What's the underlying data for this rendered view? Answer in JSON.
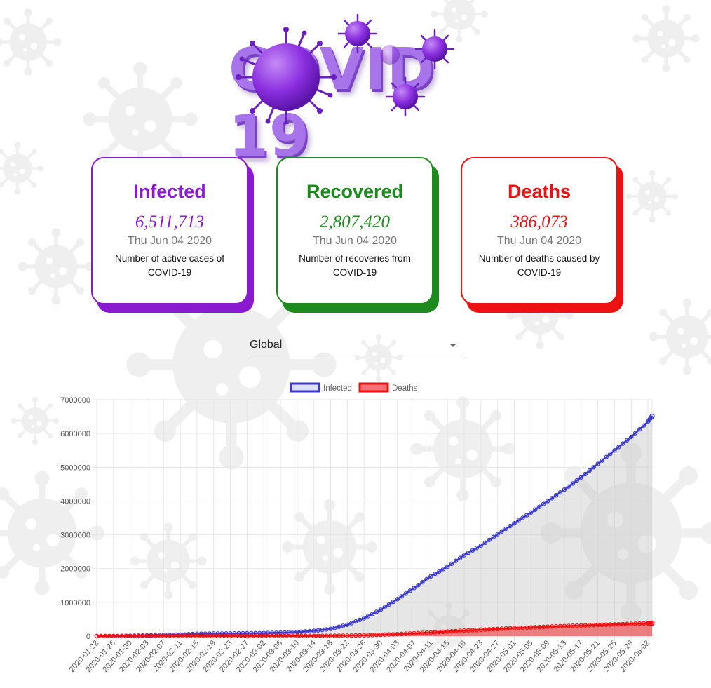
{
  "header": {
    "logo_text": "COVID 19"
  },
  "cards": [
    {
      "id": "infected",
      "title": "Infected",
      "value": "6,511,713",
      "date": "Thu Jun 04 2020",
      "description": "Number of active cases of COVID-19",
      "color": "#8a1ad0",
      "shadow_color": "#8a1ad0"
    },
    {
      "id": "recovered",
      "title": "Recovered",
      "value": "2,807,420",
      "date": "Thu Jun 04 2020",
      "description": "Number of recoveries from COVID-19",
      "color": "#1c8a1c",
      "shadow_color": "#1c8a1c"
    },
    {
      "id": "deaths",
      "title": "Deaths",
      "value": "386,073",
      "date": "Thu Jun 04 2020",
      "description": "Number of deaths caused by COVID-19",
      "color": "#ee1111",
      "shadow_color": "#ee1111"
    }
  ],
  "country_select": {
    "selected": "Global"
  },
  "colors": {
    "infected_line": "#3a3ad0",
    "infected_fill": "rgba(200,200,200,0.45)",
    "deaths_line": "#ee1111",
    "deaths_fill": "rgba(238,40,40,0.55)",
    "grid": "#e6e6e6"
  },
  "chart_data": {
    "type": "line",
    "x_start": "2020-01-22",
    "x_end": "2020-06-03",
    "x_tick_labels": [
      "2020-01-22",
      "2020-01-26",
      "2020-01-30",
      "2020-02-03",
      "2020-02-07",
      "2020-02-11",
      "2020-02-15",
      "2020-02-19",
      "2020-02-23",
      "2020-02-27",
      "2020-03-02",
      "2020-03-06",
      "2020-03-10",
      "2020-03-14",
      "2020-03-18",
      "2020-03-22",
      "2020-03-26",
      "2020-03-30",
      "2020-04-03",
      "2020-04-07",
      "2020-04-11",
      "2020-04-15",
      "2020-04-19",
      "2020-04-23",
      "2020-04-27",
      "2020-05-01",
      "2020-05-05",
      "2020-05-09",
      "2020-05-13",
      "2020-05-17",
      "2020-05-21",
      "2020-05-25",
      "2020-05-29",
      "2020-06-02"
    ],
    "y_tick_labels": [
      "0",
      "1000000",
      "2000000",
      "3000000",
      "4000000",
      "5000000",
      "6000000",
      "7000000"
    ],
    "ylim": [
      0,
      7000000
    ],
    "grid": true,
    "legend_position": "top",
    "series": [
      {
        "name": "Infected",
        "points": [
          [
            "2020-01-22",
            555
          ],
          [
            "2020-01-26",
            2100
          ],
          [
            "2020-01-30",
            9900
          ],
          [
            "2020-02-03",
            20000
          ],
          [
            "2020-02-07",
            34500
          ],
          [
            "2020-02-11",
            45200
          ],
          [
            "2020-02-15",
            69000
          ],
          [
            "2020-02-19",
            75600
          ],
          [
            "2020-02-23",
            78900
          ],
          [
            "2020-02-27",
            83000
          ],
          [
            "2020-03-02",
            90300
          ],
          [
            "2020-03-06",
            101800
          ],
          [
            "2020-03-10",
            119000
          ],
          [
            "2020-03-14",
            156000
          ],
          [
            "2020-03-18",
            214000
          ],
          [
            "2020-03-22",
            336000
          ],
          [
            "2020-03-26",
            530000
          ],
          [
            "2020-03-30",
            782000
          ],
          [
            "2020-04-03",
            1095000
          ],
          [
            "2020-04-07",
            1426000
          ],
          [
            "2020-04-11",
            1772000
          ],
          [
            "2020-04-15",
            2057000
          ],
          [
            "2020-04-19",
            2400000
          ],
          [
            "2020-04-23",
            2680000
          ],
          [
            "2020-04-27",
            3020000
          ],
          [
            "2020-05-01",
            3340000
          ],
          [
            "2020-05-05",
            3660000
          ],
          [
            "2020-05-09",
            4000000
          ],
          [
            "2020-05-13",
            4340000
          ],
          [
            "2020-05-17",
            4700000
          ],
          [
            "2020-05-21",
            5100000
          ],
          [
            "2020-05-25",
            5500000
          ],
          [
            "2020-05-29",
            5900000
          ],
          [
            "2020-06-02",
            6350000
          ],
          [
            "2020-06-03",
            6511713
          ]
        ]
      },
      {
        "name": "Deaths",
        "points": [
          [
            "2020-01-22",
            17
          ],
          [
            "2020-01-26",
            56
          ],
          [
            "2020-01-30",
            213
          ],
          [
            "2020-02-03",
            427
          ],
          [
            "2020-02-07",
            719
          ],
          [
            "2020-02-11",
            1113
          ],
          [
            "2020-02-15",
            1666
          ],
          [
            "2020-02-19",
            2122
          ],
          [
            "2020-02-23",
            2469
          ],
          [
            "2020-02-27",
            2811
          ],
          [
            "2020-03-02",
            3085
          ],
          [
            "2020-03-06",
            3460
          ],
          [
            "2020-03-10",
            4262
          ],
          [
            "2020-03-14",
            5819
          ],
          [
            "2020-03-18",
            8967
          ],
          [
            "2020-03-22",
            15000
          ],
          [
            "2020-03-26",
            24800
          ],
          [
            "2020-03-30",
            40000
          ],
          [
            "2020-04-03",
            59000
          ],
          [
            "2020-04-07",
            82000
          ],
          [
            "2020-04-11",
            108000
          ],
          [
            "2020-04-15",
            134000
          ],
          [
            "2020-04-19",
            163000
          ],
          [
            "2020-04-23",
            190000
          ],
          [
            "2020-04-27",
            211000
          ],
          [
            "2020-05-01",
            239000
          ],
          [
            "2020-05-05",
            257000
          ],
          [
            "2020-05-09",
            279000
          ],
          [
            "2020-05-13",
            298000
          ],
          [
            "2020-05-17",
            316000
          ],
          [
            "2020-05-21",
            333000
          ],
          [
            "2020-05-25",
            346000
          ],
          [
            "2020-05-29",
            363000
          ],
          [
            "2020-06-02",
            380000
          ],
          [
            "2020-06-03",
            386073
          ]
        ]
      }
    ]
  }
}
